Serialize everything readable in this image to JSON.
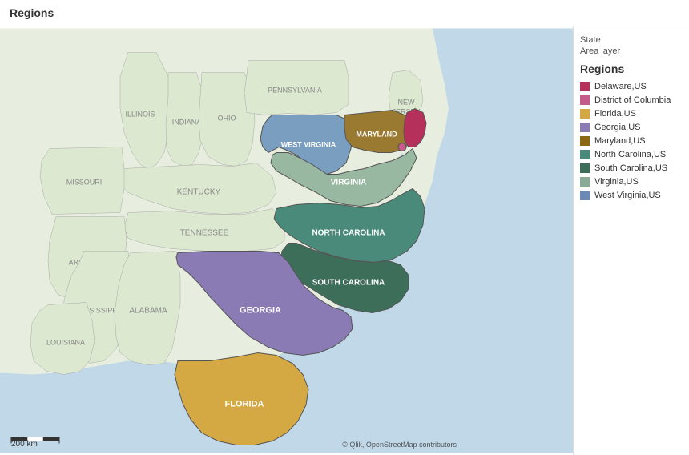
{
  "title": "Regions",
  "legend": {
    "layer_line1": "State",
    "layer_line2": "Area layer",
    "regions_title": "Regions",
    "items": [
      {
        "name": "Delaware,US",
        "color": "#b5305a"
      },
      {
        "name": "District of Columbia",
        "color": "#c45b8a"
      },
      {
        "name": "Florida,US",
        "color": "#d4a843"
      },
      {
        "name": "Georgia,US",
        "color": "#8a7bb5"
      },
      {
        "name": "Maryland,US",
        "color": "#8b6914"
      },
      {
        "name": "North Carolina,US",
        "color": "#4a8a7a"
      },
      {
        "name": "South Carolina,US",
        "color": "#3d6e5a"
      },
      {
        "name": "Virginia,US",
        "color": "#8aab98"
      },
      {
        "name": "West Virginia,US",
        "color": "#6a8ab5"
      }
    ]
  },
  "scale": {
    "label": "200 km"
  },
  "attribution": "© Qlik, OpenStreetMap contributors"
}
